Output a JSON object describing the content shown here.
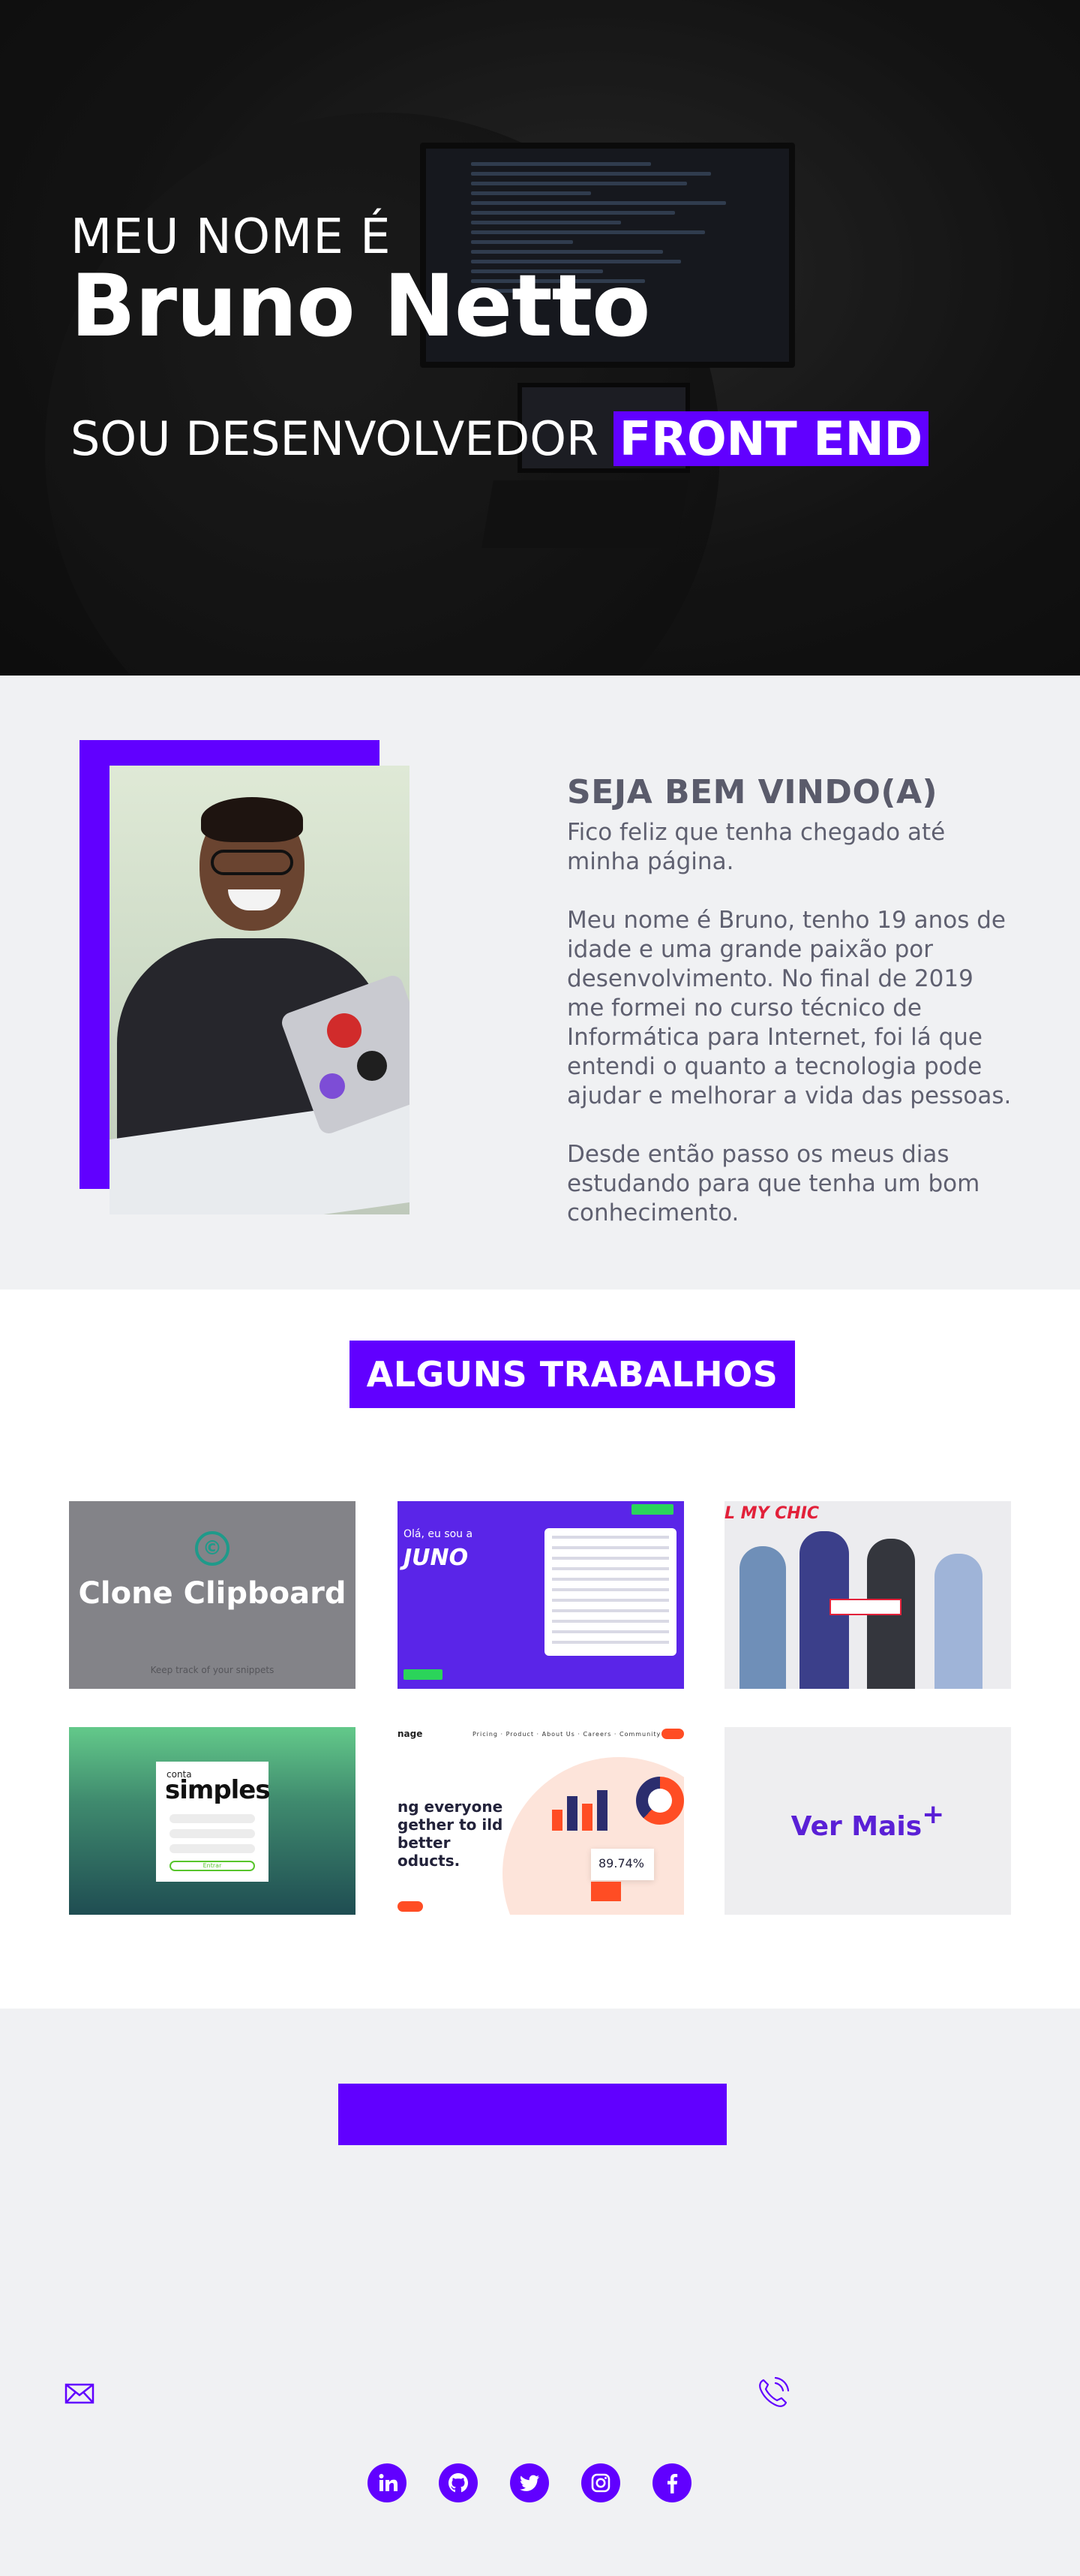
{
  "hero": {
    "intro": "MEU NOME É",
    "name": "Bruno Netto",
    "role_prefix": "SOU DESENVOLVEDOR",
    "role_highlight": "FRONT END"
  },
  "about": {
    "title": "SEJA BEM VINDO(A)",
    "paragraphs": [
      "Fico feliz que tenha chegado até minha página.",
      "Meu nome é Bruno, tenho 19 anos de idade e uma grande paixão por desenvolvimento. No final de 2019 me formei no curso técnico de Informática para Internet, foi lá que entendi o quanto a tecnologia pode ajudar e melhorar a vida das pessoas.",
      "Desde então passo os meus dias estudando para que tenha um bom conhecimento."
    ]
  },
  "works": {
    "title": "ALGUNS TRABALHOS",
    "projects": [
      {
        "title": "Clone Clipboard",
        "subtitle": "Keep track of your snippets",
        "logo_icon": "copyright-icon"
      },
      {
        "greeting": "Olá, eu sou a",
        "brand": "JUNO"
      },
      {
        "brand": "L MY CHIC"
      },
      {
        "brand_small": "conta",
        "brand_big": "simples",
        "button": "Entrar"
      },
      {
        "brand": "nage",
        "headline": "ng everyone gether to ild better oducts.",
        "stat": "89.74%"
      }
    ],
    "see_more": "Ver Mais",
    "see_more_symbol": "+"
  },
  "contact": {
    "mail_icon": "mail-icon",
    "phone_icon": "phone-icon",
    "socials": [
      "linkedin-icon",
      "github-icon",
      "twitter-icon",
      "instagram-icon",
      "facebook-icon"
    ]
  },
  "colors": {
    "accent": "#6100ff",
    "text": "#5a5b6b",
    "background": "#f0f1f3"
  }
}
